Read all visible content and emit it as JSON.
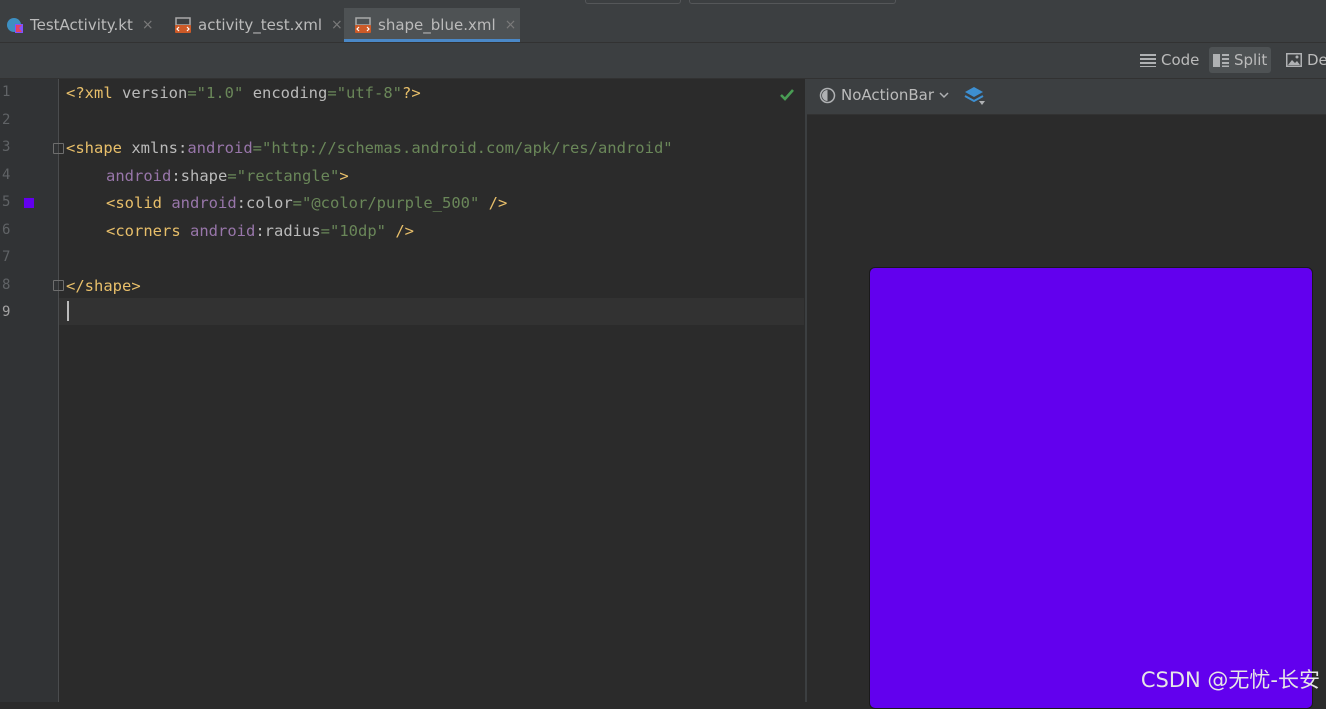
{
  "tabs": [
    {
      "label": "TestActivity.kt",
      "icon": "kotlin-file-icon",
      "active": false
    },
    {
      "label": "activity_test.xml",
      "icon": "xml-layout-file-icon",
      "active": false
    },
    {
      "label": "shape_blue.xml",
      "icon": "xml-drawable-file-icon",
      "active": true
    }
  ],
  "tab_close_glyph": "×",
  "view_modes": {
    "code": "Code",
    "split": "Split",
    "design": "De",
    "selected": "Split"
  },
  "editor": {
    "line_numbers": [
      "1",
      "2",
      "3",
      "4",
      "5",
      "6",
      "7",
      "8",
      "9"
    ],
    "current_line": "9",
    "color_swatch": "#6200ee",
    "lines": {
      "l1": {
        "open": "<?xml ",
        "a1": "version",
        "eq1": "=",
        "v1": "\"1.0\"",
        "sp": " ",
        "a2": "encoding",
        "eq2": "=",
        "v2": "\"utf-8\"",
        "close": "?>"
      },
      "l3": {
        "open": "<shape ",
        "a1": "xmlns",
        "colon": ":",
        "ns": "android",
        "eq": "=",
        "v": "\"http://schemas.android.com/apk/res/android\""
      },
      "l4": {
        "ns": "android",
        "colon": ":",
        "a": "shape",
        "eq": "=",
        "v": "\"rectangle\"",
        "close": ">"
      },
      "l5": {
        "open": "<solid ",
        "ns": "android",
        "colon": ":",
        "a": "color",
        "eq": "=",
        "v": "\"@color/purple_500\"",
        "close": " />"
      },
      "l6": {
        "open": "<corners ",
        "ns": "android",
        "colon": ":",
        "a": "radius",
        "eq": "=",
        "v": "\"10dp\"",
        "close": " />"
      },
      "l8": {
        "tag": "</shape>"
      }
    }
  },
  "preview": {
    "theme_label": "NoActionBar",
    "shape_color": "#6200ee"
  },
  "watermark": "CSDN @无忧-长安",
  "colors": {
    "accent": "#4a88c7",
    "check": "#499c54",
    "purple_500": "#6200ee"
  }
}
